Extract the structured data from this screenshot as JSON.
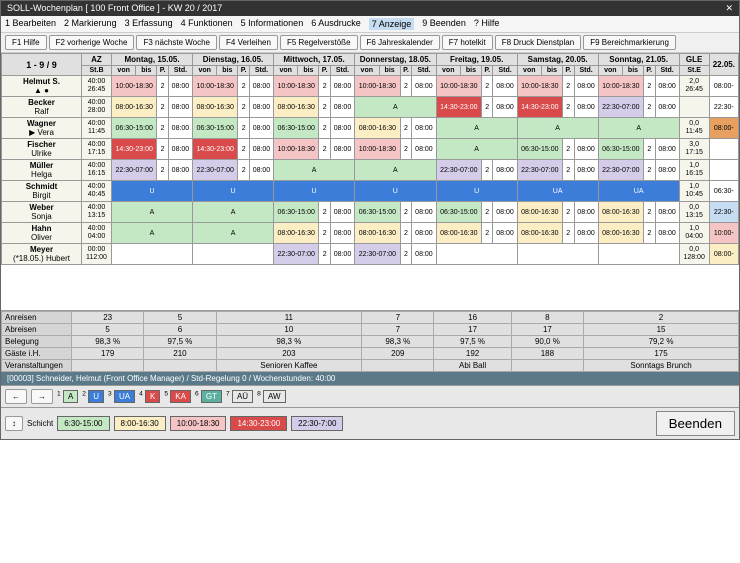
{
  "title": "SOLL-Wochenplan  [ 100 Front Office ] - KW 20 / 2017",
  "menu": [
    "1 Bearbeiten",
    "2 Markierung",
    "3 Erfassung",
    "4 Funktionen",
    "5 Informationen",
    "6 Ausdrucke",
    "7 Anzeige",
    "9 Beenden",
    "? Hilfe"
  ],
  "toolbar": [
    "F1 Hilfe",
    "F2 vorherige Woche",
    "F3 nächste Woche",
    "F4 Verleihen",
    "F5 Regelverstöße",
    "F6 Jahreskalender",
    "F7 hotelkit",
    "F8 Druck Dienstplan",
    "F9 Bereichmarkierung"
  ],
  "nav": "1 - 9 / 9",
  "az_head": "AZ",
  "stb_head": "St.B",
  "gle_head": "GLE",
  "ste_head": "St.E",
  "days": [
    "Montag, 15.05.",
    "Dienstag, 16.05.",
    "Mittwoch, 17.05.",
    "Donnerstag, 18.05.",
    "Freitag, 19.05.",
    "Samstag, 20.05.",
    "Sonntag, 21.05."
  ],
  "sub": [
    "von",
    "bis",
    "P.",
    "Std."
  ],
  "extra_day": "22.05.",
  "rows": [
    {
      "name": "Helmut S.",
      "sub": "▲ ●",
      "az": "40:00\n26:45",
      "cells": [
        {
          "t": "10:00-18:30",
          "c": "c-pink",
          "p": "2",
          "s": "08:00"
        },
        {
          "t": "10:00-18:30",
          "c": "c-pink",
          "p": "2",
          "s": "08:00"
        },
        {
          "t": "10:00-18:30",
          "c": "c-pink",
          "p": "2",
          "s": "08:00"
        },
        {
          "t": "10:00-18:30",
          "c": "c-pink",
          "p": "2",
          "s": "08:00"
        },
        {
          "t": "10:00-18:30",
          "c": "c-pink",
          "p": "2",
          "s": "08:00"
        },
        {
          "t": "10:00-18:30",
          "c": "c-pink",
          "p": "2",
          "s": "08:00"
        },
        {
          "t": "10:00-18:30",
          "c": "c-pink",
          "p": "2",
          "s": "08:00"
        }
      ],
      "gle": "2,0\n26:45",
      "ex": "08:00-"
    },
    {
      "name": "Becker",
      "sub": "Ralf",
      "az": "40:00\n28:00",
      "cells": [
        {
          "t": "08:00-16:30",
          "c": "c-yellow",
          "p": "2",
          "s": "08:00"
        },
        {
          "t": "08:00-16:30",
          "c": "c-yellow",
          "p": "2",
          "s": "08:00"
        },
        {
          "t": "08:00-16:30",
          "c": "c-yellow",
          "p": "2",
          "s": "08:00"
        },
        {
          "t": "A",
          "c": "c-green"
        },
        {
          "t": "14:30-23:00",
          "c": "c-red",
          "p": "2",
          "s": "08:00"
        },
        {
          "t": "14:30-23:00",
          "c": "c-red",
          "p": "2",
          "s": "08:00"
        },
        {
          "t": "22:30-07:00",
          "c": "c-purple",
          "p": "2",
          "s": "08:00"
        }
      ],
      "gle": "",
      "ex": "22:30-"
    },
    {
      "name": "Wagner",
      "sub": "▶ Vera",
      "az": "40:00\n11:45",
      "cells": [
        {
          "t": "06:30-15:00",
          "c": "c-green",
          "p": "2",
          "s": "08:00"
        },
        {
          "t": "06:30-15:00",
          "c": "c-green",
          "p": "2",
          "s": "08:00"
        },
        {
          "t": "06:30-15:00",
          "c": "c-green",
          "p": "2",
          "s": "08:00"
        },
        {
          "t": "08:00-16:30",
          "c": "c-yellow",
          "p": "2",
          "s": "08:00"
        },
        {
          "t": "A",
          "c": "c-green"
        },
        {
          "t": "A",
          "c": "c-green"
        },
        {
          "t": "A",
          "c": "c-green"
        }
      ],
      "gle": "0,0\n11:45",
      "ex": "08:00-",
      "exc": "c-orange"
    },
    {
      "name": "Fischer",
      "sub": "Ulrike",
      "az": "40:00\n17:15",
      "cells": [
        {
          "t": "14:30-23:00",
          "c": "c-red",
          "p": "2",
          "s": "08:00"
        },
        {
          "t": "14:30-23:00",
          "c": "c-red",
          "p": "2",
          "s": "08:00"
        },
        {
          "t": "10:00-18:30",
          "c": "c-pink",
          "p": "2",
          "s": "08:00"
        },
        {
          "t": "10:00-18:30",
          "c": "c-pink",
          "p": "2",
          "s": "08:00"
        },
        {
          "t": "A",
          "c": "c-green"
        },
        {
          "t": "06:30-15:00",
          "c": "c-green",
          "p": "2",
          "s": "08:00"
        },
        {
          "t": "06:30-15:00",
          "c": "c-green",
          "p": "2",
          "s": "08:00"
        }
      ],
      "gle": "3,0\n17:15",
      "ex": ""
    },
    {
      "name": "Müller",
      "sub": "Helga",
      "az": "40:00\n16:15",
      "cells": [
        {
          "t": "22:30-07:00",
          "c": "c-purple",
          "p": "2",
          "s": "08:00"
        },
        {
          "t": "22:30-07:00",
          "c": "c-purple",
          "p": "2",
          "s": "08:00"
        },
        {
          "t": "A",
          "c": "c-green"
        },
        {
          "t": "A",
          "c": "c-green"
        },
        {
          "t": "22:30-07:00",
          "c": "c-purple",
          "p": "2",
          "s": "08:00"
        },
        {
          "t": "22:30-07:00",
          "c": "c-purple",
          "p": "2",
          "s": "08:00"
        },
        {
          "t": "22:30-07:00",
          "c": "c-purple",
          "p": "2",
          "s": "08:00"
        }
      ],
      "gle": "1,0\n16:15",
      "ex": ""
    },
    {
      "name": "Schmidt",
      "sub": "Birgit",
      "az": "40:00\n40:45",
      "cells": [
        {
          "t": "U",
          "c": "c-blue"
        },
        {
          "t": "U",
          "c": "c-blue"
        },
        {
          "t": "U",
          "c": "c-blue"
        },
        {
          "t": "U",
          "c": "c-blue"
        },
        {
          "t": "U",
          "c": "c-blue"
        },
        {
          "t": "UA",
          "c": "c-blue"
        },
        {
          "t": "UA",
          "c": "c-blue"
        }
      ],
      "gle": "1,0\n10:45",
      "ex": "06:30-"
    },
    {
      "name": "Weber",
      "sub": "Sonja",
      "az": "40:00\n13:15",
      "cells": [
        {
          "t": "A",
          "c": "c-green"
        },
        {
          "t": "A",
          "c": "c-green"
        },
        {
          "t": "06:30-15:00",
          "c": "c-green",
          "p": "2",
          "s": "08:00"
        },
        {
          "t": "06:30-15:00",
          "c": "c-green",
          "p": "2",
          "s": "08:00"
        },
        {
          "t": "06:30-15:00",
          "c": "c-green",
          "p": "2",
          "s": "08:00"
        },
        {
          "t": "08:00-16:30",
          "c": "c-yellow",
          "p": "2",
          "s": "08:00"
        },
        {
          "t": "08:00-16:30",
          "c": "c-yellow",
          "p": "2",
          "s": "08:00"
        }
      ],
      "gle": "0,0\n13:15",
      "ex": "22:30-",
      "exc": "c-ltblue"
    },
    {
      "name": "Hahn",
      "sub": "Oliver",
      "az": "40:00\n04:00",
      "cells": [
        {
          "t": "A",
          "c": "c-green"
        },
        {
          "t": "A",
          "c": "c-green"
        },
        {
          "t": "08:00-16:30",
          "c": "c-yellow",
          "p": "2",
          "s": "08:00"
        },
        {
          "t": "08:00-16:30",
          "c": "c-yellow",
          "p": "2",
          "s": "08:00"
        },
        {
          "t": "08:00-16:30",
          "c": "c-yellow",
          "p": "2",
          "s": "08:00"
        },
        {
          "t": "08:00-16:30",
          "c": "c-yellow",
          "p": "2",
          "s": "08:00"
        },
        {
          "t": "08:00-16:30",
          "c": "c-yellow",
          "p": "2",
          "s": "08:00"
        }
      ],
      "gle": "1,0\n04:00",
      "ex": "10:00-",
      "exc": "c-pink"
    },
    {
      "name": "Meyer",
      "sub": "(*18.05.) Hubert",
      "az": "00:00\n112:00",
      "cells": [
        {
          "t": ""
        },
        {
          "t": ""
        },
        {
          "t": "22:30-07:00",
          "c": "c-purple",
          "p": "2",
          "s": "08:00"
        },
        {
          "t": "22:30-07:00",
          "c": "c-purple",
          "p": "2",
          "s": "08:00"
        },
        {
          "t": ""
        },
        {
          "t": ""
        },
        {
          "t": ""
        }
      ],
      "gle": "0,0\n128:00",
      "ex": "08:00-",
      "exc": "c-yellow"
    }
  ],
  "summary": [
    {
      "l": "Anreisen",
      "v": [
        "23",
        "5",
        "11",
        "7",
        "16",
        "8",
        "2"
      ]
    },
    {
      "l": "Abreisen",
      "v": [
        "5",
        "6",
        "10",
        "7",
        "17",
        "17",
        "15"
      ]
    },
    {
      "l": "Belegung",
      "v": [
        "98,3 %",
        "97,5 %",
        "98,3 %",
        "98,3 %",
        "97,5 %",
        "90,0 %",
        "79,2 %"
      ]
    },
    {
      "l": "Gäste i.H.",
      "v": [
        "179",
        "210",
        "203",
        "209",
        "192",
        "188",
        "175"
      ]
    },
    {
      "l": "Veranstaltungen",
      "v": [
        "",
        "",
        "Senioren Kaffee",
        "",
        "Abi Ball",
        "",
        "Sonntags Brunch"
      ]
    }
  ],
  "status": "[00003] Schneider, Helmut (Front Office Manager) / Std-Regelung 0 / Wochenstunden: 40:00",
  "legend": [
    {
      "n": "1",
      "t": "A",
      "c": "c-green"
    },
    {
      "n": "2",
      "t": "U",
      "c": "c-blue"
    },
    {
      "n": "3",
      "t": "UA",
      "c": "c-blue"
    },
    {
      "n": "4",
      "t": "K",
      "c": "c-red"
    },
    {
      "n": "5",
      "t": "KA",
      "c": "c-red"
    },
    {
      "n": "6",
      "t": "GT",
      "c": "c-teal"
    },
    {
      "n": "7",
      "t": "AÜ",
      "c": ""
    },
    {
      "n": "8",
      "t": "AW",
      "c": ""
    }
  ],
  "shift_label": "Schicht",
  "shifts": [
    {
      "t": "6:30-15:00",
      "c": "c-green"
    },
    {
      "t": "8:00-16:30",
      "c": "c-yellow"
    },
    {
      "t": "10:00-18:30",
      "c": "c-pink"
    },
    {
      "t": "14:30-23:00",
      "c": "c-red"
    },
    {
      "t": "22:30-7:00",
      "c": "c-purple"
    }
  ],
  "end_btn": "Beenden"
}
